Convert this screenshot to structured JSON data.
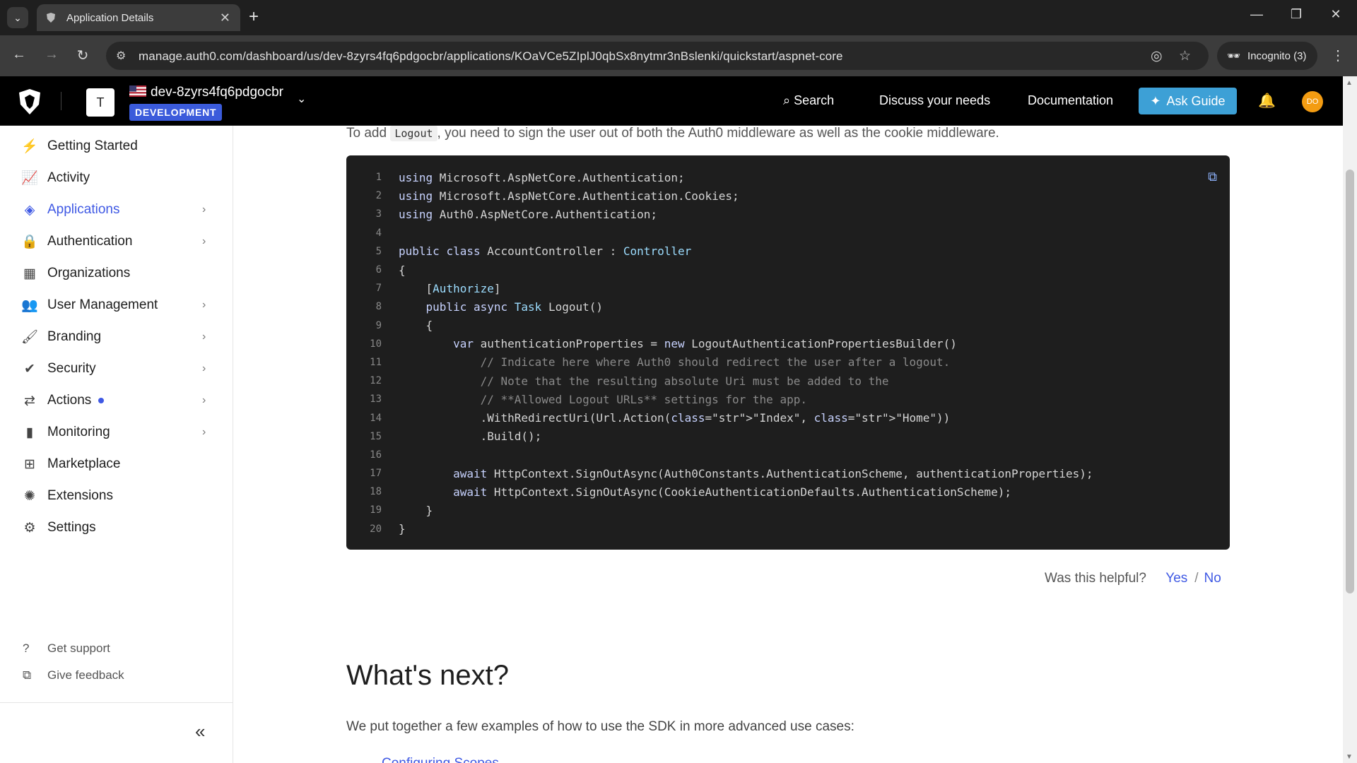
{
  "browser": {
    "tab_title": "Application Details",
    "url": "manage.auth0.com/dashboard/us/dev-8zyrs4fq6pdgocbr/applications/KOaVCe5ZIplJ0qbSx8nytmr3nBslenki/quickstart/aspnet-core",
    "incognito_label": "Incognito (3)"
  },
  "header": {
    "tenant_initial": "T",
    "tenant_name": "dev-8zyrs4fq6pdgocbr",
    "env_badge": "DEVELOPMENT",
    "search": "Search",
    "discuss": "Discuss your needs",
    "documentation": "Documentation",
    "ask_guide": "Ask Guide",
    "user_initials": "DO",
    "ask_color": "#3da0d6"
  },
  "sidebar": {
    "items": [
      {
        "label": "Getting Started",
        "icon": "bolt-icon"
      },
      {
        "label": "Activity",
        "icon": "activity-icon"
      },
      {
        "label": "Applications",
        "icon": "layers-icon"
      },
      {
        "label": "Authentication",
        "icon": "lock-icon"
      },
      {
        "label": "Organizations",
        "icon": "building-icon"
      },
      {
        "label": "User Management",
        "icon": "users-icon"
      },
      {
        "label": "Branding",
        "icon": "brush-icon"
      },
      {
        "label": "Security",
        "icon": "shield-check-icon"
      },
      {
        "label": "Actions",
        "icon": "actions-icon"
      },
      {
        "label": "Monitoring",
        "icon": "bar-chart-icon"
      },
      {
        "label": "Marketplace",
        "icon": "marketplace-icon"
      },
      {
        "label": "Extensions",
        "icon": "extension-icon"
      },
      {
        "label": "Settings",
        "icon": "gear-icon"
      }
    ],
    "get_support": "Get support",
    "give_feedback": "Give feedback"
  },
  "main": {
    "intro_before": "To add ",
    "intro_code": "Logout",
    "intro_after": ", you need to sign the user out of both the Auth0 middleware as well as the cookie middleware.",
    "code_lines": [
      "using Microsoft.AspNetCore.Authentication;",
      "using Microsoft.AspNetCore.Authentication.Cookies;",
      "using Auth0.AspNetCore.Authentication;",
      "",
      "public class AccountController : Controller",
      "{",
      "    [Authorize]",
      "    public async Task Logout()",
      "    {",
      "        var authenticationProperties = new LogoutAuthenticationPropertiesBuilder()",
      "            // Indicate here where Auth0 should redirect the user after a logout.",
      "            // Note that the resulting absolute Uri must be added to the",
      "            // **Allowed Logout URLs** settings for the app.",
      "            .WithRedirectUri(Url.Action(\"Index\", \"Home\"))",
      "            .Build();",
      "",
      "        await HttpContext.SignOutAsync(Auth0Constants.AuthenticationScheme, authenticationProperties);",
      "        await HttpContext.SignOutAsync(CookieAuthenticationDefaults.AuthenticationScheme);",
      "    }",
      "}"
    ],
    "helpful_question": "Was this helpful?",
    "yes": "Yes",
    "separator": "/",
    "no": "No",
    "whats_next": "What's next?",
    "whats_next_text": "We put together a few examples of how to use the SDK in more advanced use cases:",
    "next_link": "Configuring Scopes"
  }
}
